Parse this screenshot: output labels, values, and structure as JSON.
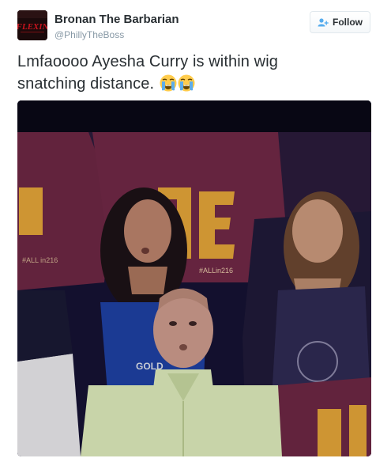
{
  "user": {
    "fullname": "Bronan The Barbarian",
    "username": "@PhillyTheBoss",
    "avatar_icon": "flexin-logo-avatar",
    "avatar_text": "FLEXIN"
  },
  "follow_button": {
    "label": "Follow",
    "icon": "add-user-icon"
  },
  "tweet": {
    "text_line1": "Lmfaoooo Ayesha Curry is within wig",
    "text_line2": "snatching distance.",
    "emojis": [
      "loudly-crying-face",
      "loudly-crying-face"
    ]
  },
  "media": {
    "type": "photo",
    "jersey_text_left": "#ALL in216",
    "jersey_text_center": "#ALLin216"
  },
  "colors": {
    "text": "#292f33",
    "secondary": "#8899a6",
    "border": "#e1e8ed",
    "jersey_wine": "#6b2743",
    "jersey_gold": "#e0a238"
  }
}
